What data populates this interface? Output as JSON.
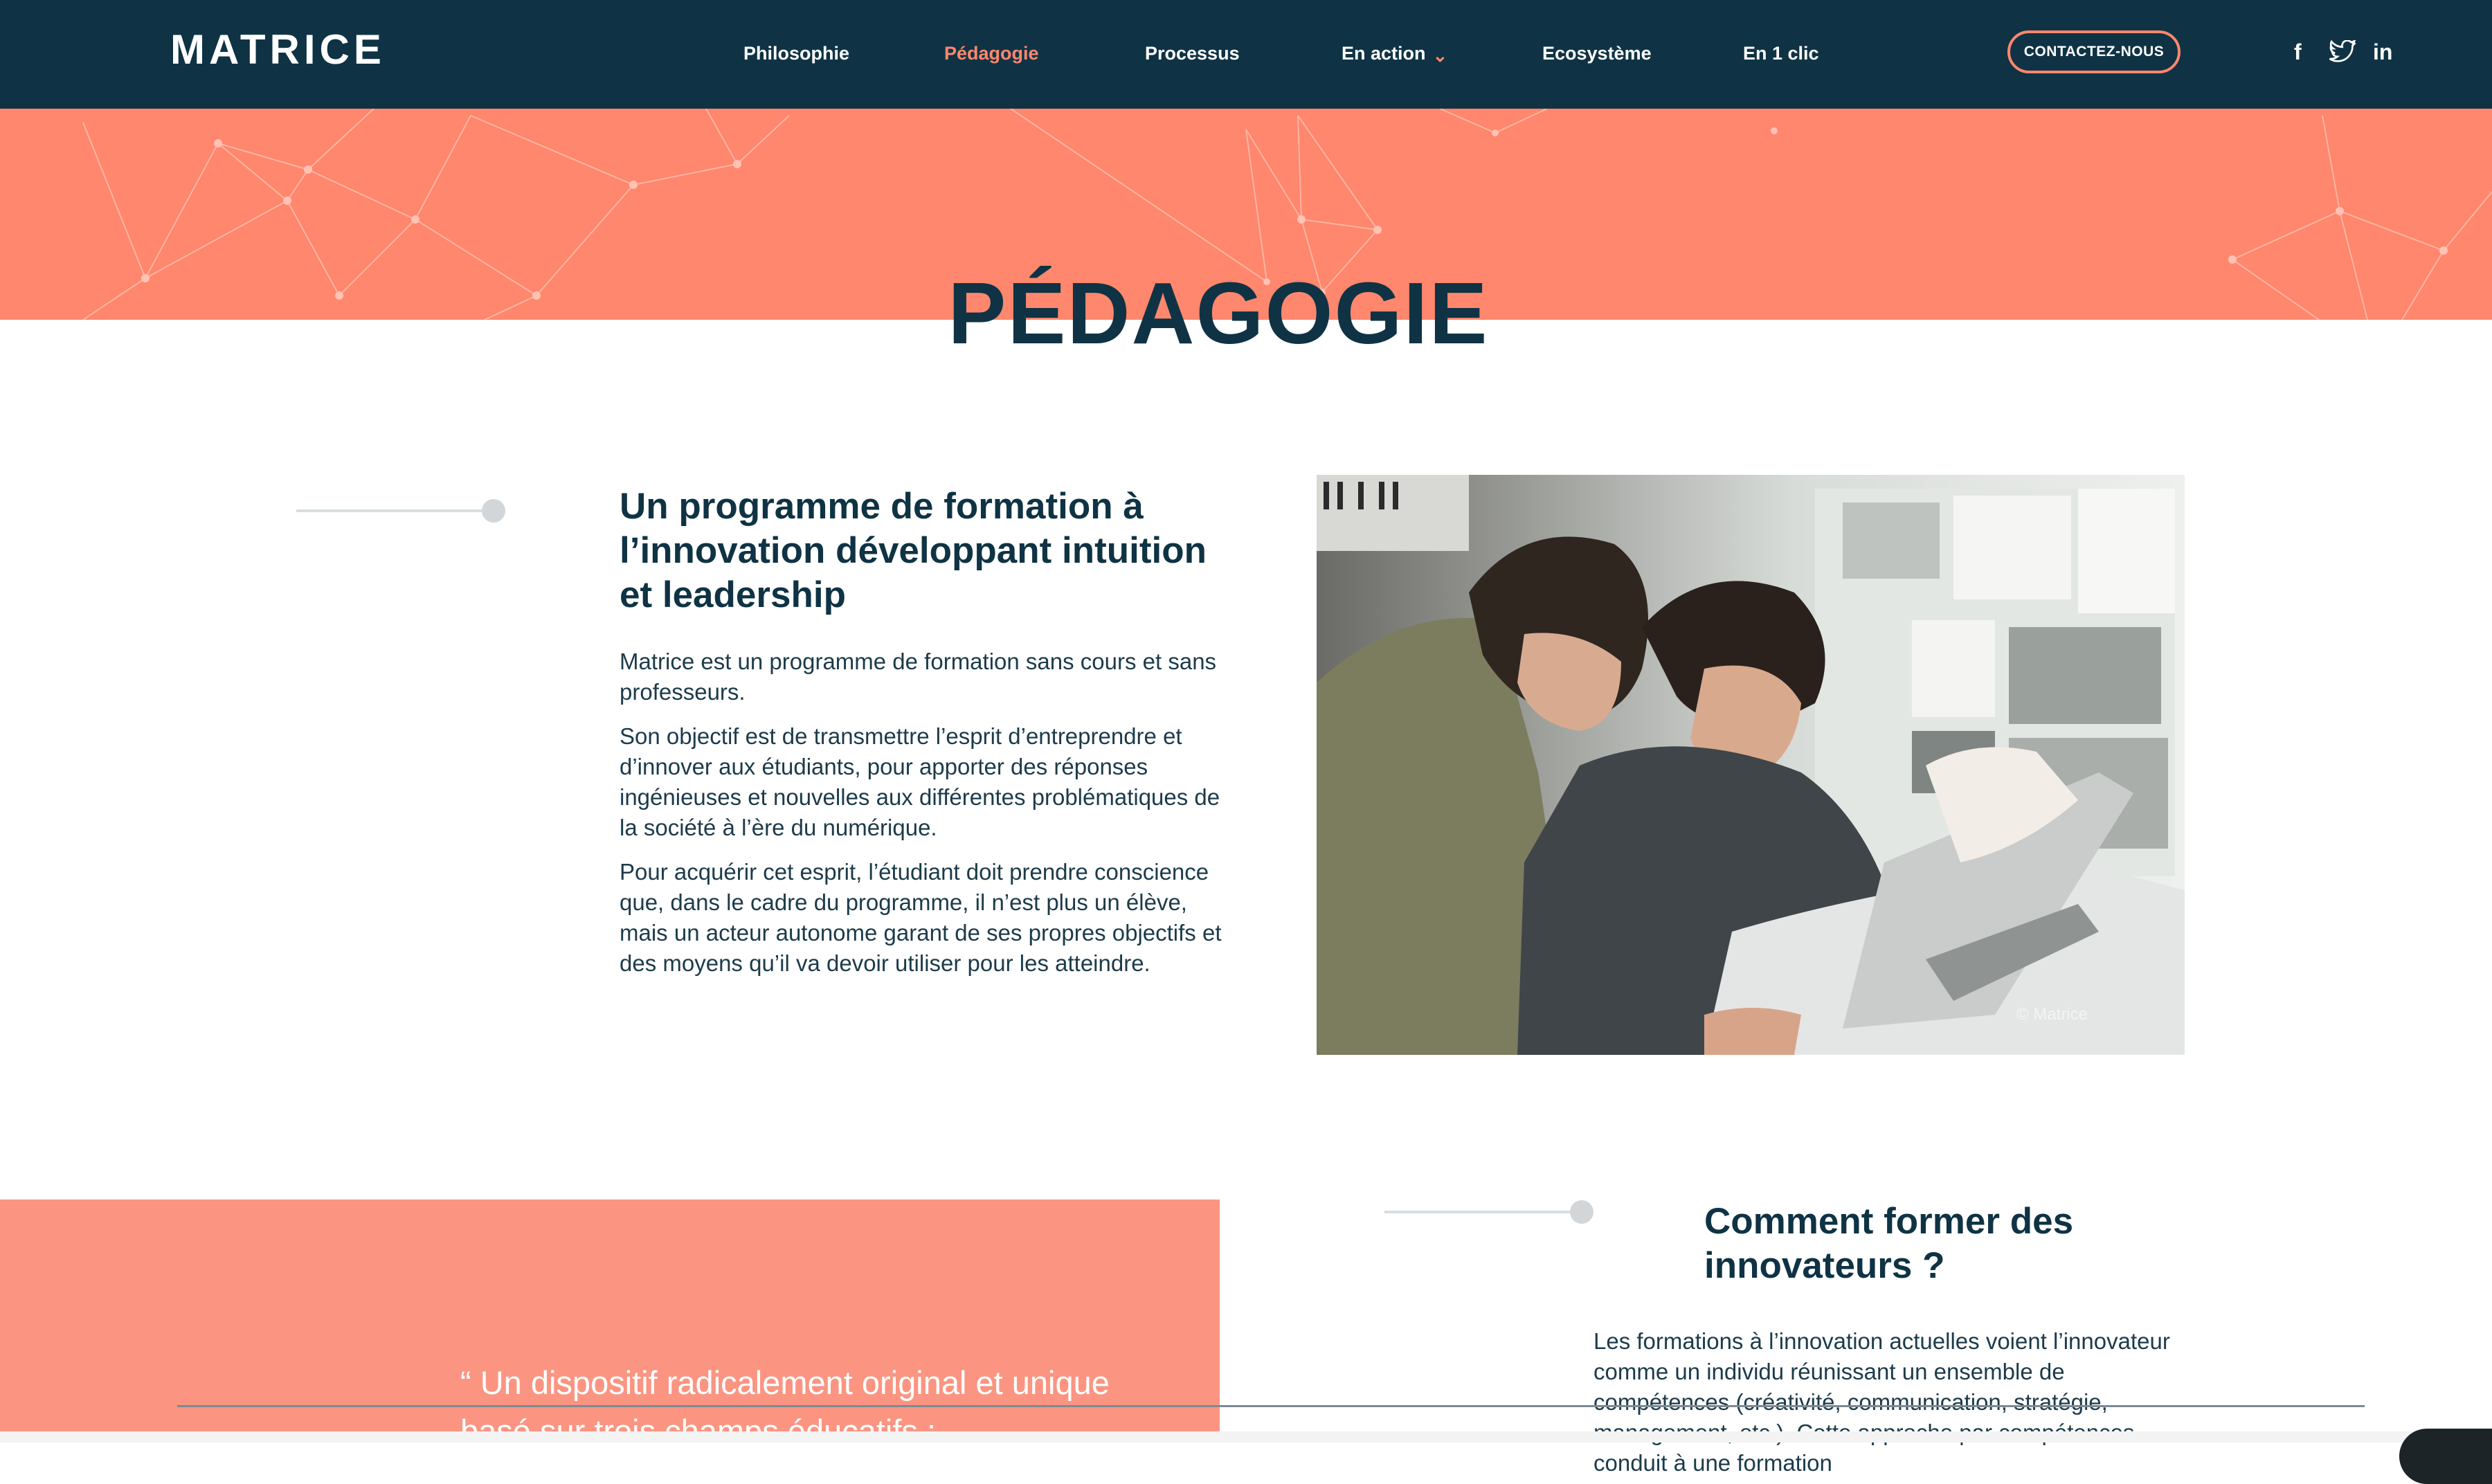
{
  "header": {
    "logo": "MATRICE",
    "nav": [
      {
        "label": "Philosophie"
      },
      {
        "label": "Pédagogie",
        "active": true
      },
      {
        "label": "Processus"
      },
      {
        "label": "En action",
        "dropdown": true
      },
      {
        "label": "Ecosystème"
      },
      {
        "label": "En 1 clic"
      }
    ],
    "contact_label": "CONTACTEZ-NOUS",
    "social": [
      {
        "label": "f",
        "icon": "facebook-icon"
      },
      {
        "label": "twitter",
        "icon": "twitter-icon"
      },
      {
        "label": "in",
        "icon": "linkedin-icon"
      }
    ]
  },
  "page": {
    "title": "PÉDAGOGIE"
  },
  "section1": {
    "heading": "Un programme de formation à l’innovation développant intuition et leadership",
    "paragraphs": [
      "Matrice est un programme de formation sans cours et sans professeurs.",
      "Son objectif est de transmettre l’esprit d’entreprendre et d’innover aux étudiants, pour apporter des réponses ingénieuses et nouvelles aux différentes problématiques de la société à l’ère du numérique.",
      "Pour acquérir cet esprit, l’étudiant doit prendre conscience que, dans le cadre du programme, il n’est plus un élève, mais un acteur autonome garant de ses propres objectifs et des moyens qu’il va devoir utiliser pour les atteindre."
    ],
    "photo_credit": "© Matrice"
  },
  "section2": {
    "quote": "“ Un dispositif radicalement original et unique basé sur trois champs éducatifs :",
    "heading": "Comment former des innovateurs ?",
    "paragraph": "Les formations à l’innovation actuelles voient l’innovateur comme un individu réunissant un ensemble de compétences (créativité, communication, stratégie, management, etc.). Cette approche par compétences conduit à une formation"
  },
  "colors": {
    "navy": "#0f3344",
    "salmon": "#ff876d",
    "quote_bg": "#fb9582"
  }
}
